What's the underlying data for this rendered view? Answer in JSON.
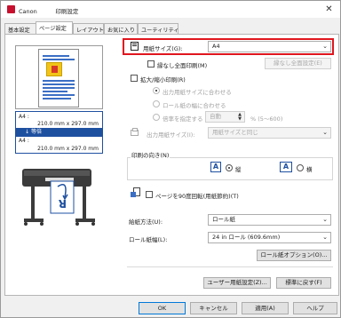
{
  "window": {
    "title": "Canon          印刷設定",
    "close_label": "✕"
  },
  "tabs": [
    {
      "label": "基本設定"
    },
    {
      "label": "ページ設定",
      "active": true
    },
    {
      "label": "レイアウト"
    },
    {
      "label": "お気に入り"
    },
    {
      "label": "ユーティリティ"
    }
  ],
  "preview": {
    "size_top_name": "A4 :",
    "size_top_dims": "210.0 mm x 297.0 mm",
    "scale_label": "等倍",
    "size_bottom_name": "A4 :",
    "size_bottom_dims": "210.0 mm x 297.0 mm"
  },
  "page_size": {
    "label": "用紙サイズ(G):",
    "value": "A4"
  },
  "borderless": {
    "checkbox_label": "縁なし全面印刷(M)",
    "checked": false,
    "settings_button": "縁なし全面設定(E)"
  },
  "scaling": {
    "checkbox_label": "拡大/縮小印刷(R)",
    "checked": false,
    "options": [
      {
        "label": "出力用紙サイズに合わせる",
        "selected": true
      },
      {
        "label": "ロール紙の幅に合わせる",
        "selected": false
      },
      {
        "label": "倍率を指定する",
        "selected": false
      }
    ],
    "scale_value": "自動",
    "scale_unit": "% (5～600)"
  },
  "output_size": {
    "label": "出力用紙サイズ(I):",
    "value": "用紙サイズと同じ"
  },
  "orientation": {
    "legend": "印刷の向き(N)",
    "portrait_label": "縦",
    "landscape_label": "横",
    "selected": "portrait",
    "icon_letter": "A"
  },
  "rotate90": {
    "label": "ページを90度回転(用紙節約)(T)",
    "checked": false
  },
  "paper_source": {
    "label": "給紙方法(U):",
    "value": "ロール紙"
  },
  "roll_width": {
    "label": "ロール紙幅(L):",
    "value": "24 in ロール (609.6mm)"
  },
  "roll_options_button": "ロール紙オプション(O)...",
  "custom_paper_button": "ユーザー用紙設定(Z)...",
  "defaults_button": "標準に戻す(F)",
  "footer": {
    "ok": "OK",
    "cancel": "キャンセル",
    "apply": "適用(A)",
    "help": "ヘルプ"
  },
  "colors": {
    "accent": "#1e50a0",
    "highlight_frame": "#e0161e",
    "brand": "#c8102e"
  }
}
